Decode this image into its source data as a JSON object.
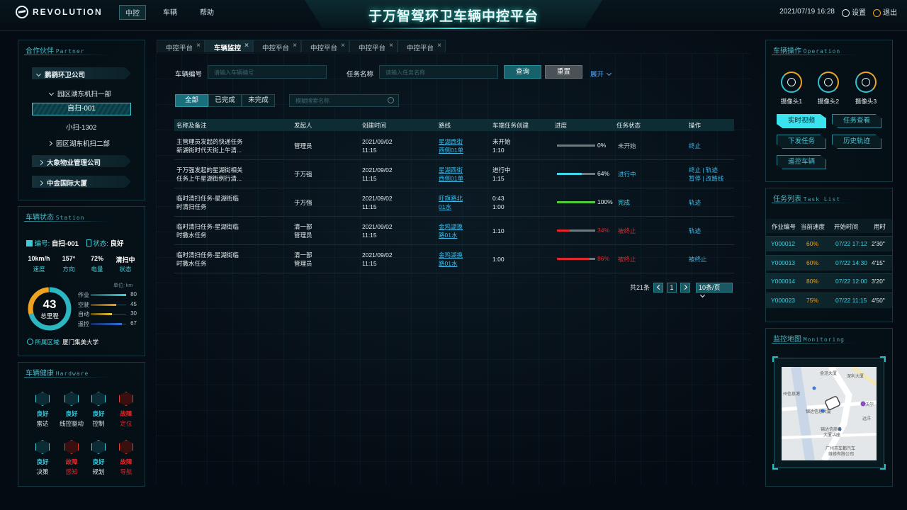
{
  "header": {
    "brand": "REVOLUTION",
    "nav": [
      {
        "label": "中控",
        "active": true
      },
      {
        "label": "车辆",
        "active": false
      },
      {
        "label": "帮助",
        "active": false
      }
    ],
    "title": "于万智驾环卫车辆中控平台",
    "datetime": "2021/07/19 16:28",
    "settings": "设置",
    "logout": "退出"
  },
  "partner": {
    "title": "合作伙伴",
    "title_en": "Partner",
    "tree": [
      {
        "label": "鹏鹞环卫公司"
      },
      {
        "label": "园区湖东机扫一部"
      },
      {
        "label": "自扫-001",
        "selected": true
      },
      {
        "label": "小扫-1302"
      },
      {
        "label": "园区湖东机扫二部"
      },
      {
        "label": "大象物业管理公司"
      },
      {
        "label": "中金国际大厦"
      }
    ]
  },
  "station": {
    "title": "车辆状态",
    "title_en": "Station",
    "id_label": "编号:",
    "id_value": "自扫-001",
    "state_label": "状态:",
    "state_value": "良好",
    "metrics": [
      {
        "value": "10km/h",
        "label": "速度"
      },
      {
        "value": "157°",
        "label": "方向"
      },
      {
        "value": "72%",
        "label": "电量"
      },
      {
        "value": "清扫中",
        "label": "状态"
      }
    ],
    "unit": "单位: km",
    "total": "43",
    "total_label": "总里程",
    "legend": [
      {
        "label": "作业",
        "value": "80",
        "color": "#3fd3d8"
      },
      {
        "label": "空驶",
        "value": "45",
        "color": "#f0a21f"
      },
      {
        "label": "自动",
        "value": "30",
        "color": "#f0c830"
      },
      {
        "label": "遥控",
        "value": "67",
        "color": "#2f6fe0"
      }
    ],
    "area_label": "所属区域:",
    "area_value": "厦门集美大学"
  },
  "hardware": {
    "title": "车辆健康",
    "title_en": "Hardware",
    "items": [
      {
        "status": "良好",
        "name": "雷达",
        "ok": true
      },
      {
        "status": "良好",
        "name": "线控驱动",
        "ok": true
      },
      {
        "status": "良好",
        "name": "控制",
        "ok": true
      },
      {
        "status": "故障",
        "name": "定位",
        "ok": false
      },
      {
        "status": "良好",
        "name": "决策",
        "ok": true
      },
      {
        "status": "故障",
        "name": "感知",
        "ok": false
      },
      {
        "status": "良好",
        "name": "规划",
        "ok": true
      },
      {
        "status": "故障",
        "name": "导航",
        "ok": false
      }
    ]
  },
  "tabs": [
    {
      "label": "中控平台",
      "active": false
    },
    {
      "label": "车辆监控",
      "active": true
    },
    {
      "label": "中控平台",
      "active": false
    },
    {
      "label": "中控平台",
      "active": false
    },
    {
      "label": "中控平台",
      "active": false
    },
    {
      "label": "中控平台",
      "active": false
    }
  ],
  "filter": {
    "vehicle_label": "车辆编号",
    "vehicle_placeholder": "请输入车辆编号",
    "task_label": "任务名称",
    "task_placeholder": "请输入任务名称",
    "query": "查询",
    "reset": "重置",
    "expand": "展开"
  },
  "segments": [
    "全部",
    "已完成",
    "未完成"
  ],
  "search_placeholder": "模糊搜索名称",
  "table": {
    "headers": [
      "名称及备注",
      "发起人",
      "创建时间",
      "路线",
      "车端任务创建",
      "进度",
      "任务状态",
      "操作"
    ],
    "rows": [
      {
        "name": [
          "主管理员发起的快递任务",
          "新湖街时代天街上午清..."
        ],
        "owner": [
          "管理员"
        ],
        "time": [
          "2021/09/02",
          "11:15"
        ],
        "route": [
          "星湖西街",
          "西侧01单"
        ],
        "create": [
          "未开始",
          "1:10"
        ],
        "progress": 0,
        "pct": "0%",
        "pcolor": "#c8d0d3",
        "status": "未开始",
        "scolor": "#b9c6ca",
        "ops": [
          "终止"
        ]
      },
      {
        "name": [
          "于万强发起的星湖街相关",
          "任务上午星湖街例行清..."
        ],
        "owner": [
          "于万强"
        ],
        "time": [
          "2021/09/02",
          "11:15"
        ],
        "route": [
          "星湖西街",
          "西侧01单"
        ],
        "create": [
          "进行中",
          "1:15"
        ],
        "progress": 64,
        "pct": "64%",
        "pcolor": "#3fd8ec",
        "status": "进行中",
        "scolor": "#3db9e6",
        "ops": [
          "终止 | 轨迹",
          "暂停 | 改路线"
        ]
      },
      {
        "name": [
          "临时清扫任务-星湖街临",
          "时清扫任务"
        ],
        "owner": [
          "于万强"
        ],
        "time": [
          "2021/09/02",
          "11:15"
        ],
        "route": [
          "旺旗路北",
          "01水"
        ],
        "create": [
          "0:43",
          "1:00"
        ],
        "progress": 100,
        "pct": "100%",
        "pcolor": "#4ecb3a",
        "status": "完成",
        "scolor": "#3fd8ec",
        "ops": [
          "轨迹"
        ]
      },
      {
        "name": [
          "临时清扫任务-星湖街临",
          "时撒水任务"
        ],
        "owner": [
          "清一部",
          "管理员"
        ],
        "time": [
          "2021/09/02",
          "11:15"
        ],
        "route": [
          "金鸡湖换",
          "路01水"
        ],
        "create": [
          "1:10"
        ],
        "progress": 34,
        "pct": "34%",
        "pcolor": "#e0262a",
        "status": "被终止",
        "scolor": "#e0262a",
        "ops": [
          "轨迹"
        ]
      },
      {
        "name": [
          "临时清扫任务-星湖街临",
          "时撒水任务"
        ],
        "owner": [
          "清一部",
          "管理员"
        ],
        "time": [
          "2021/09/02",
          "11:15"
        ],
        "route": [
          "金鸡湖换",
          "路01水"
        ],
        "create": [
          "1:00"
        ],
        "progress": 86,
        "pct": "86%",
        "pcolor": "#e0262a",
        "status": "被终止",
        "scolor": "#e0262a",
        "ops": [
          "被终止"
        ]
      }
    ]
  },
  "pagination": {
    "total": "共21条",
    "page": "1",
    "size": "10条/页"
  },
  "operation": {
    "title": "车辆操作",
    "title_en": "Operation",
    "cameras": [
      "摄像头1",
      "摄像头2",
      "摄像头3"
    ],
    "buttons": [
      {
        "label": "实时视频",
        "active": true
      },
      {
        "label": "任务查看",
        "active": false
      },
      {
        "label": "下发任务",
        "active": false
      },
      {
        "label": "历史轨迹",
        "active": false
      },
      {
        "label": "遥控车辆",
        "active": false
      }
    ]
  },
  "tasklist": {
    "title": "任务列表",
    "title_en": "Task List",
    "headers": [
      "作业编号",
      "当前速度",
      "开始时间",
      "用时"
    ],
    "rows": [
      {
        "id": "Y000012",
        "speed": "60%",
        "start": "07/22 17:12",
        "dur": "2'30\""
      },
      {
        "id": "Y000013",
        "speed": "60%",
        "start": "07/22 14:30",
        "dur": "4'15\""
      },
      {
        "id": "Y000014",
        "speed": "80%",
        "start": "07/22 12:00",
        "dur": "3'20\""
      },
      {
        "id": "Y000023",
        "speed": "75%",
        "start": "07/22 11:15",
        "dur": "4'50\""
      }
    ]
  },
  "monitoring": {
    "title": "监控地图",
    "title_en": "Monitoring",
    "labels": [
      "金迅大厦",
      "深利大厦",
      "州信息港",
      "沃尔",
      "锦达信息大厦",
      "远洋",
      "锦达信商务",
      "大厦-A座",
      "广州市车都汽车",
      "维修有限公司"
    ]
  }
}
